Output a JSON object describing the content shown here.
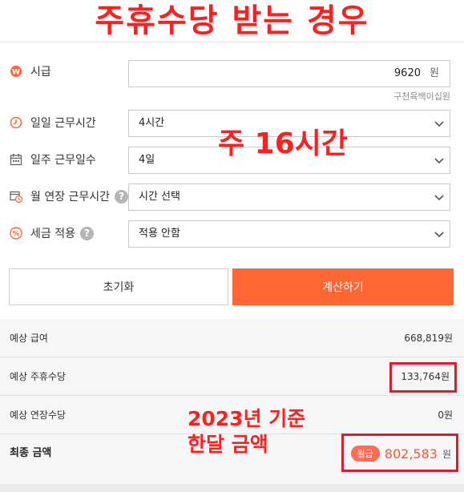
{
  "banner": "주휴수당 받는 경우",
  "form": {
    "hourly": {
      "label": "시급",
      "value": "9620",
      "unit": "원",
      "hint": "구천육백이십원"
    },
    "daily_hours": {
      "label": "일일 근무시간",
      "value": "4시간"
    },
    "weekly_days": {
      "label": "일주 근무일수",
      "value": "4일"
    },
    "overtime": {
      "label": "월 연장 근무시간",
      "value": "시간 선택",
      "help": "?"
    },
    "tax": {
      "label": "세금 적용",
      "value": "적용 안함",
      "help": "?"
    }
  },
  "buttons": {
    "reset": "초기화",
    "calculate": "계산하기"
  },
  "results": {
    "salary": {
      "label": "예상 급여",
      "amount": "668,819원"
    },
    "holiday": {
      "label": "예상 주휴수당",
      "amount": "133,764원"
    },
    "overtime": {
      "label": "예상 연장수당",
      "amount": "0원"
    },
    "total": {
      "label": "최종 금액",
      "badge": "월급",
      "amount": "802,583",
      "unit": "원"
    }
  },
  "annotations": {
    "weekly": "주 16시간",
    "basis_line1": "2023년 기준",
    "basis_line2": "한달 금액"
  },
  "colors": {
    "accent": "#ff6633",
    "annotation": "#ff1f1f",
    "total": "#ff5533"
  },
  "icons": {
    "hourly": "won-coin-icon",
    "daily_hours": "clock-icon",
    "weekly_days": "calendar-icon",
    "overtime": "calendar-clock-icon",
    "tax": "percent-icon"
  }
}
